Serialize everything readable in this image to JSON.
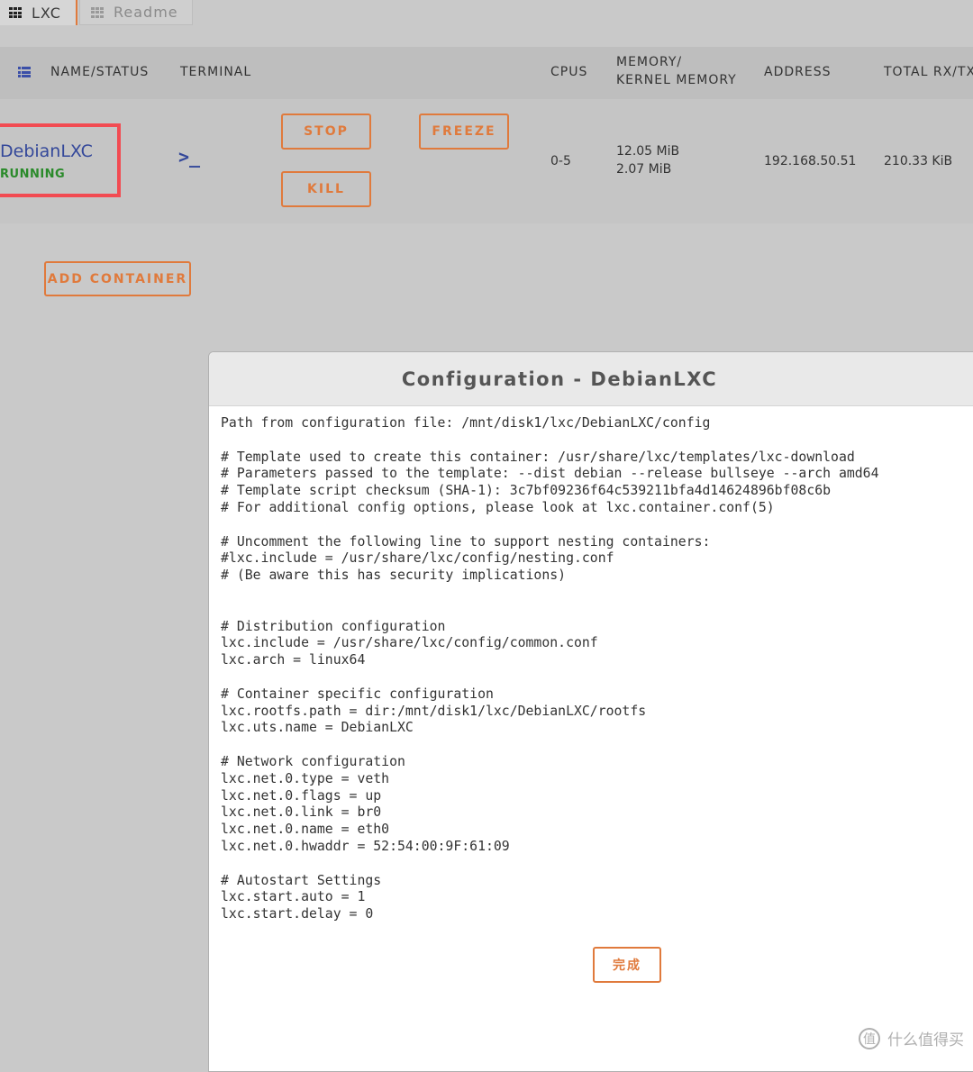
{
  "tabs": [
    {
      "label": "LXC",
      "active": true,
      "icon": "grid-icon"
    },
    {
      "label": "Readme",
      "active": false,
      "icon": "grid-icon"
    }
  ],
  "table": {
    "headers": {
      "name_status": "NAME/STATUS",
      "terminal": "TERMINAL",
      "cpus": "CPUS",
      "memory_line1": "MEMORY/",
      "memory_line2": "KERNEL MEMORY",
      "address": "ADDRESS",
      "total": "TOTAL RX/TX"
    },
    "row": {
      "name": "DebianLXC",
      "status": "RUNNING",
      "terminal_glyph": ">_",
      "stop": "STOP",
      "kill": "KILL",
      "freeze": "FREEZE",
      "cpus": "0-5",
      "memory": "12.05 MiB",
      "kernel_memory": "2.07 MiB",
      "address": "192.168.50.51",
      "total": "210.33 KiB"
    }
  },
  "add_container": "ADD CONTAINER",
  "modal": {
    "title": "Configuration - DebianLXC",
    "config_text": "Path from configuration file: /mnt/disk1/lxc/DebianLXC/config\n\n# Template used to create this container: /usr/share/lxc/templates/lxc-download\n# Parameters passed to the template: --dist debian --release bullseye --arch amd64\n# Template script checksum (SHA-1): 3c7bf09236f64c539211bfa4d14624896bf08c6b\n# For additional config options, please look at lxc.container.conf(5)\n\n# Uncomment the following line to support nesting containers:\n#lxc.include = /usr/share/lxc/config/nesting.conf\n# (Be aware this has security implications)\n\n\n# Distribution configuration\nlxc.include = /usr/share/lxc/config/common.conf\nlxc.arch = linux64\n\n# Container specific configuration\nlxc.rootfs.path = dir:/mnt/disk1/lxc/DebianLXC/rootfs\nlxc.uts.name = DebianLXC\n\n# Network configuration\nlxc.net.0.type = veth\nlxc.net.0.flags = up\nlxc.net.0.link = br0\nlxc.net.0.name = eth0\nlxc.net.0.hwaddr = 52:54:00:9F:61:09\n\n# Autostart Settings\nlxc.start.auto = 1\nlxc.start.delay = 0",
    "done": "完成"
  },
  "watermark": {
    "icon_glyph": "值",
    "text": "什么值得买"
  },
  "colors": {
    "accent": "#e07a3c",
    "link": "#34489a",
    "running": "#2a8a2a",
    "highlight": "#f24b52"
  }
}
